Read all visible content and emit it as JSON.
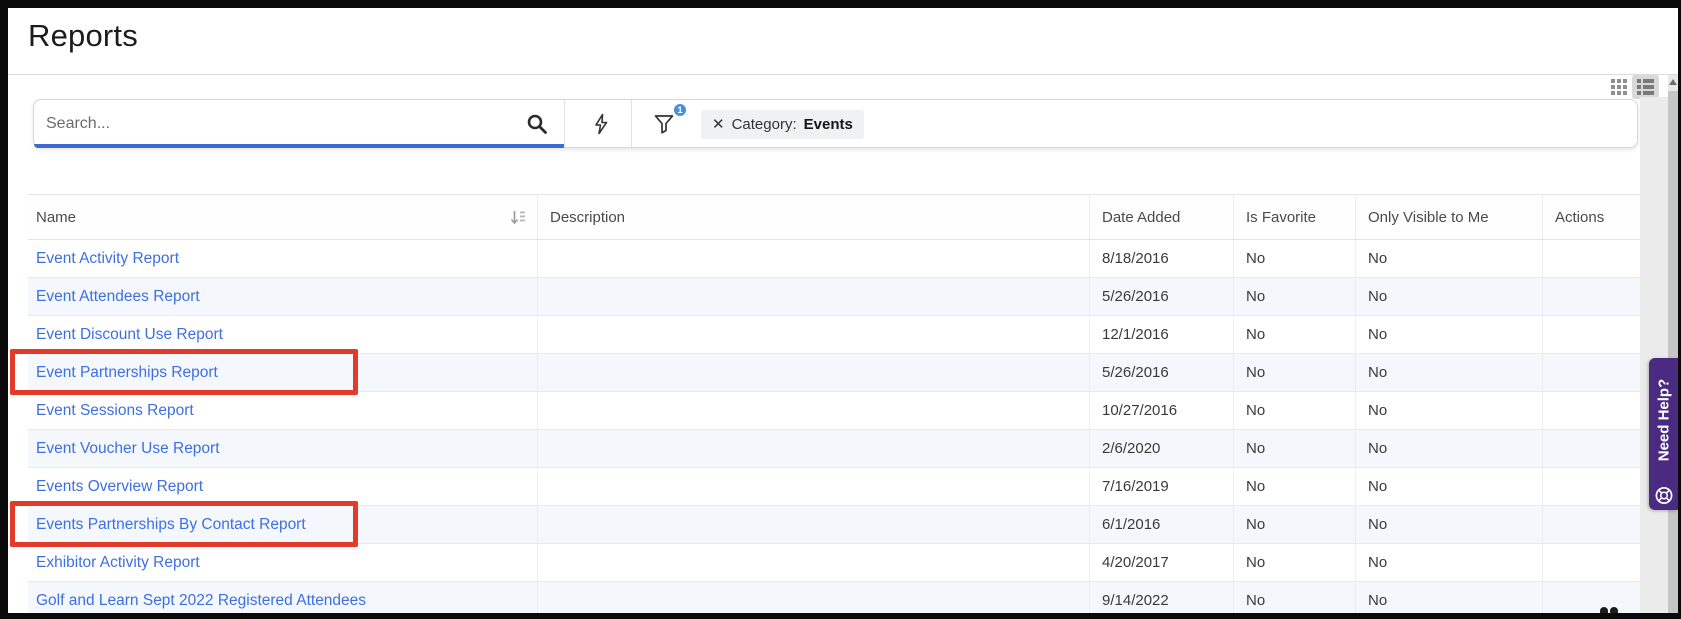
{
  "header": {
    "title": "Reports"
  },
  "toolbar": {
    "search": {
      "placeholder": "Search...",
      "value": ""
    },
    "filter_badge_count": "1",
    "filter_chip": {
      "label": "Category:",
      "value": "Events"
    },
    "icons": {
      "close": "✕"
    }
  },
  "view_toggle": {
    "selected": "list"
  },
  "help_tab": {
    "label": "Need Help?"
  },
  "table": {
    "columns": [
      {
        "label": "Name"
      },
      {
        "label": "Description"
      },
      {
        "label": "Date Added"
      },
      {
        "label": "Is Favorite"
      },
      {
        "label": "Only Visible to Me"
      },
      {
        "label": "Actions"
      }
    ],
    "rows": [
      {
        "name": "Event Activity Report",
        "description": "",
        "date_added": "8/18/2016",
        "is_favorite": "No",
        "only_visible_to_me": "No",
        "highlighted": false
      },
      {
        "name": "Event Attendees Report",
        "description": "",
        "date_added": "5/26/2016",
        "is_favorite": "No",
        "only_visible_to_me": "No",
        "highlighted": false
      },
      {
        "name": "Event Discount Use Report",
        "description": "",
        "date_added": "12/1/2016",
        "is_favorite": "No",
        "only_visible_to_me": "No",
        "highlighted": false
      },
      {
        "name": "Event Partnerships Report",
        "description": "",
        "date_added": "5/26/2016",
        "is_favorite": "No",
        "only_visible_to_me": "No",
        "highlighted": true
      },
      {
        "name": "Event Sessions Report",
        "description": "",
        "date_added": "10/27/2016",
        "is_favorite": "No",
        "only_visible_to_me": "No",
        "highlighted": false
      },
      {
        "name": "Event Voucher Use Report",
        "description": "",
        "date_added": "2/6/2020",
        "is_favorite": "No",
        "only_visible_to_me": "No",
        "highlighted": false
      },
      {
        "name": "Events Overview Report",
        "description": "",
        "date_added": "7/16/2019",
        "is_favorite": "No",
        "only_visible_to_me": "No",
        "highlighted": false
      },
      {
        "name": "Events Partnerships By Contact Report",
        "description": "",
        "date_added": "6/1/2016",
        "is_favorite": "No",
        "only_visible_to_me": "No",
        "highlighted": true
      },
      {
        "name": "Exhibitor Activity Report",
        "description": "",
        "date_added": "4/20/2017",
        "is_favorite": "No",
        "only_visible_to_me": "No",
        "highlighted": false
      },
      {
        "name": "Golf and Learn Sept 2022 Registered Attendees",
        "description": "",
        "date_added": "9/14/2022",
        "is_favorite": "No",
        "only_visible_to_me": "No",
        "highlighted": false
      }
    ]
  },
  "colors": {
    "link": "#3e6fe1",
    "row_alt": "#f4f7fc",
    "highlight_red": "#e23b2c",
    "help_purple": "#4b2b82",
    "badge_blue": "#4a90d5",
    "search_underline": "#3f6ad4"
  }
}
